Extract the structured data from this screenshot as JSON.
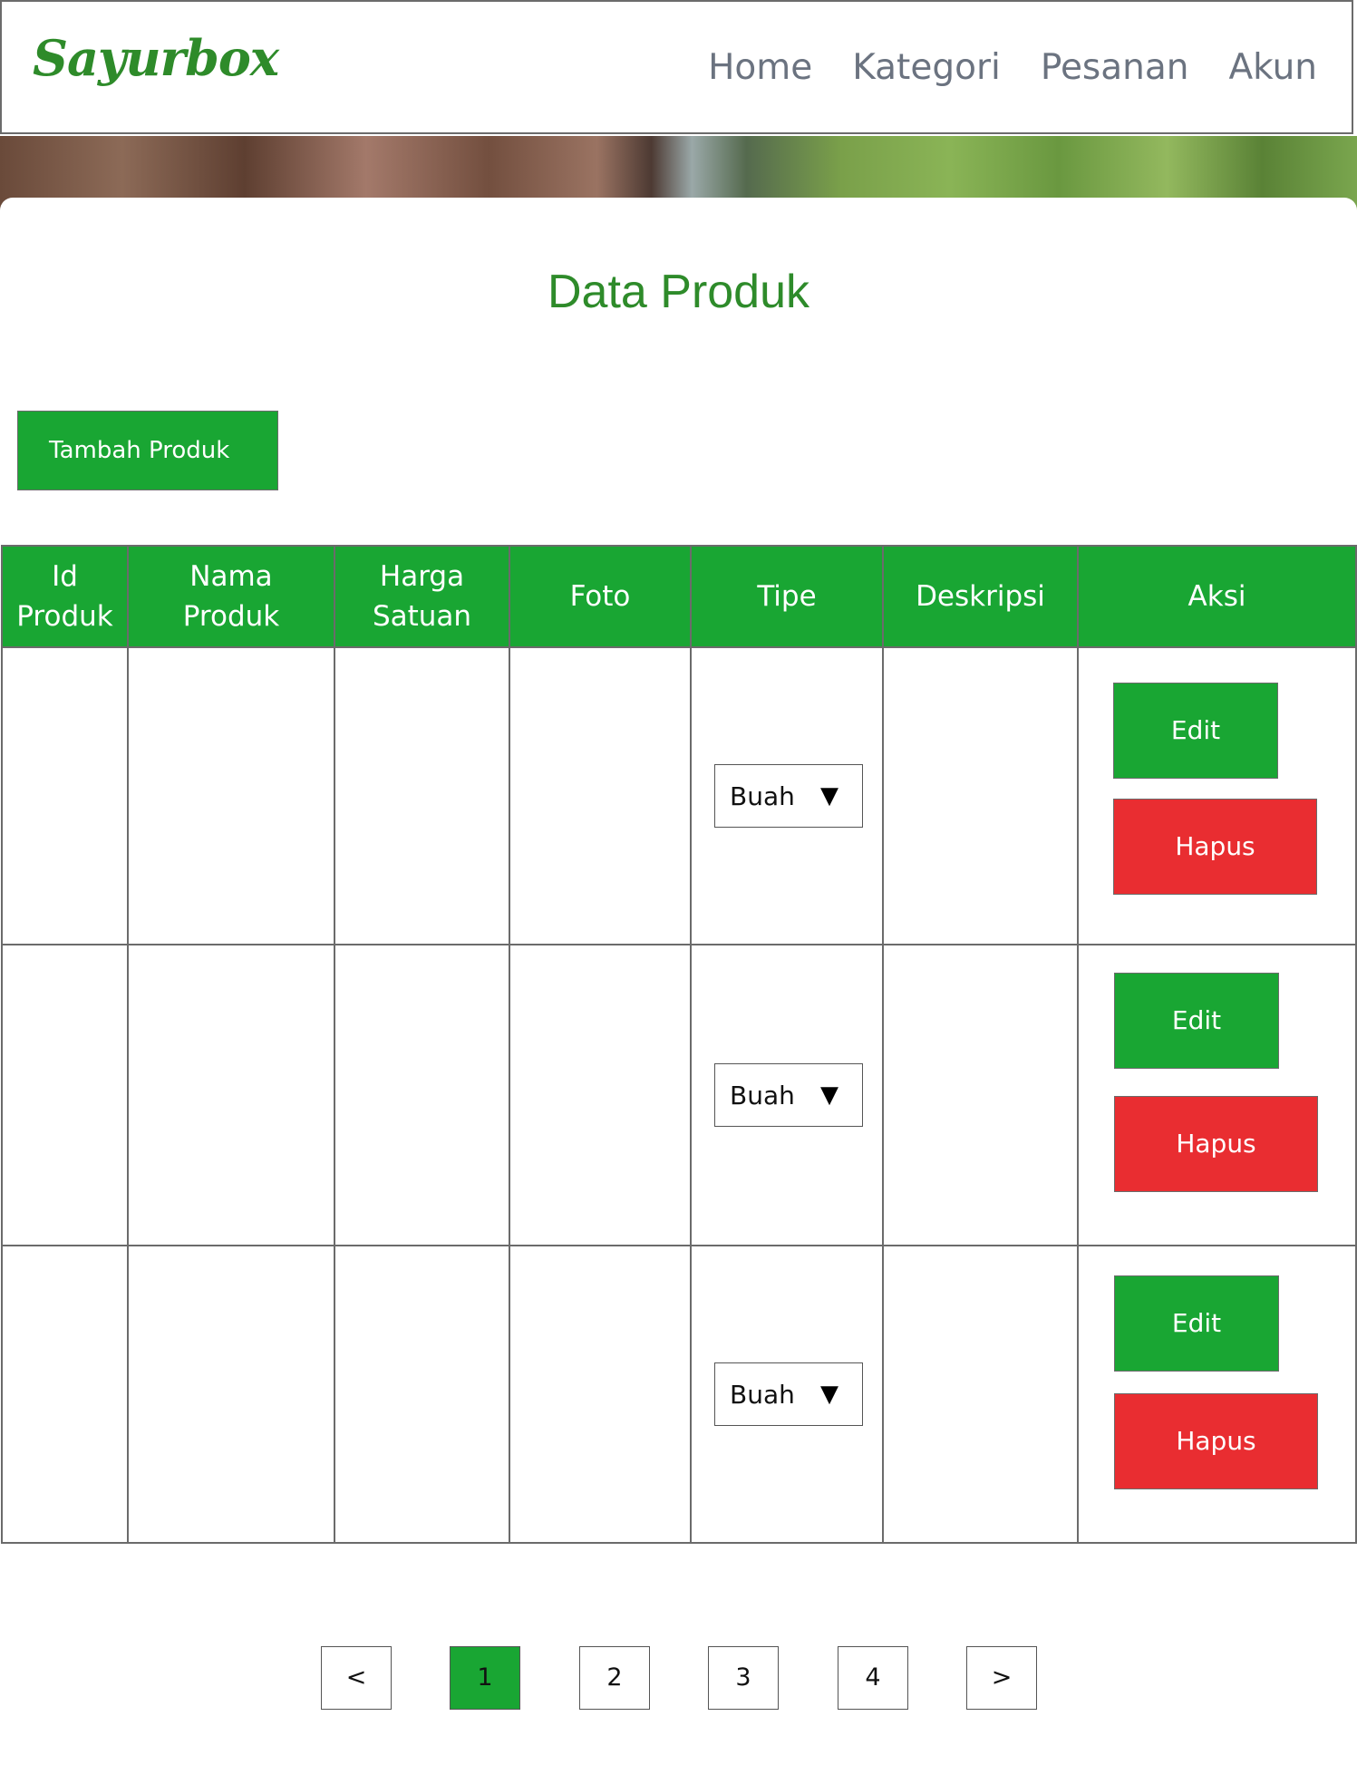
{
  "header": {
    "brand": "Sayurbox",
    "nav": [
      "Home",
      "Kategori",
      "Pesanan",
      "Akun"
    ]
  },
  "page": {
    "title": "Data Produk",
    "add_button": "Tambah Produk"
  },
  "table": {
    "headers": [
      "Id Produk",
      "Nama Produk",
      "Harga Satuan",
      "Foto",
      "Tipe",
      "Deskripsi",
      "Aksi"
    ],
    "rows": [
      {
        "tipe": "Buah",
        "edit": "Edit",
        "hapus": "Hapus"
      },
      {
        "tipe": "Buah",
        "edit": "Edit",
        "hapus": "Hapus"
      },
      {
        "tipe": "Buah",
        "edit": "Edit",
        "hapus": "Hapus"
      }
    ]
  },
  "pagination": {
    "prev": "<",
    "pages": [
      "1",
      "2",
      "3",
      "4"
    ],
    "next": ">",
    "active_page": "1"
  },
  "colors": {
    "brand_green": "#2e8b2a",
    "button_green": "#19a633",
    "danger_red": "#e92d31",
    "nav_gray": "#6b7380"
  }
}
